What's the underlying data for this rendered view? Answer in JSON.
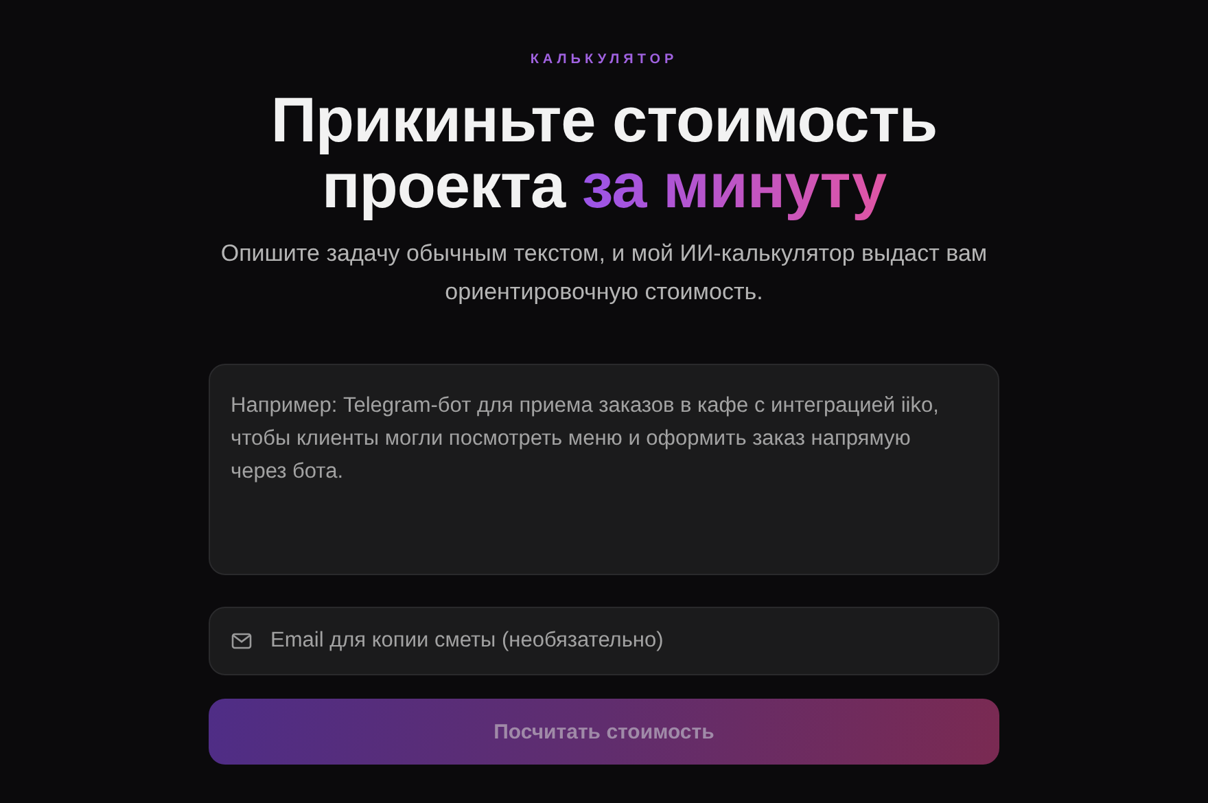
{
  "eyebrow": "КАЛЬКУЛЯТОР",
  "title": {
    "text": "Прикиньте стоимость проекта",
    "accent": "за минуту"
  },
  "subtitle": "Опишите задачу обычным текстом, и мой ИИ-калькулятор выдаст вам ориентировочную стоимость.",
  "description_field": {
    "placeholder": "Например: Telegram-бот для приема заказов в кафе с интеграцией iiko, чтобы клиенты могли посмотреть меню и оформить заказ напрямую через бота."
  },
  "email_field": {
    "placeholder": "Email для копии сметы (необязательно)"
  },
  "submit_button": {
    "label": "Посчитать стоимость",
    "disabled": true
  }
}
